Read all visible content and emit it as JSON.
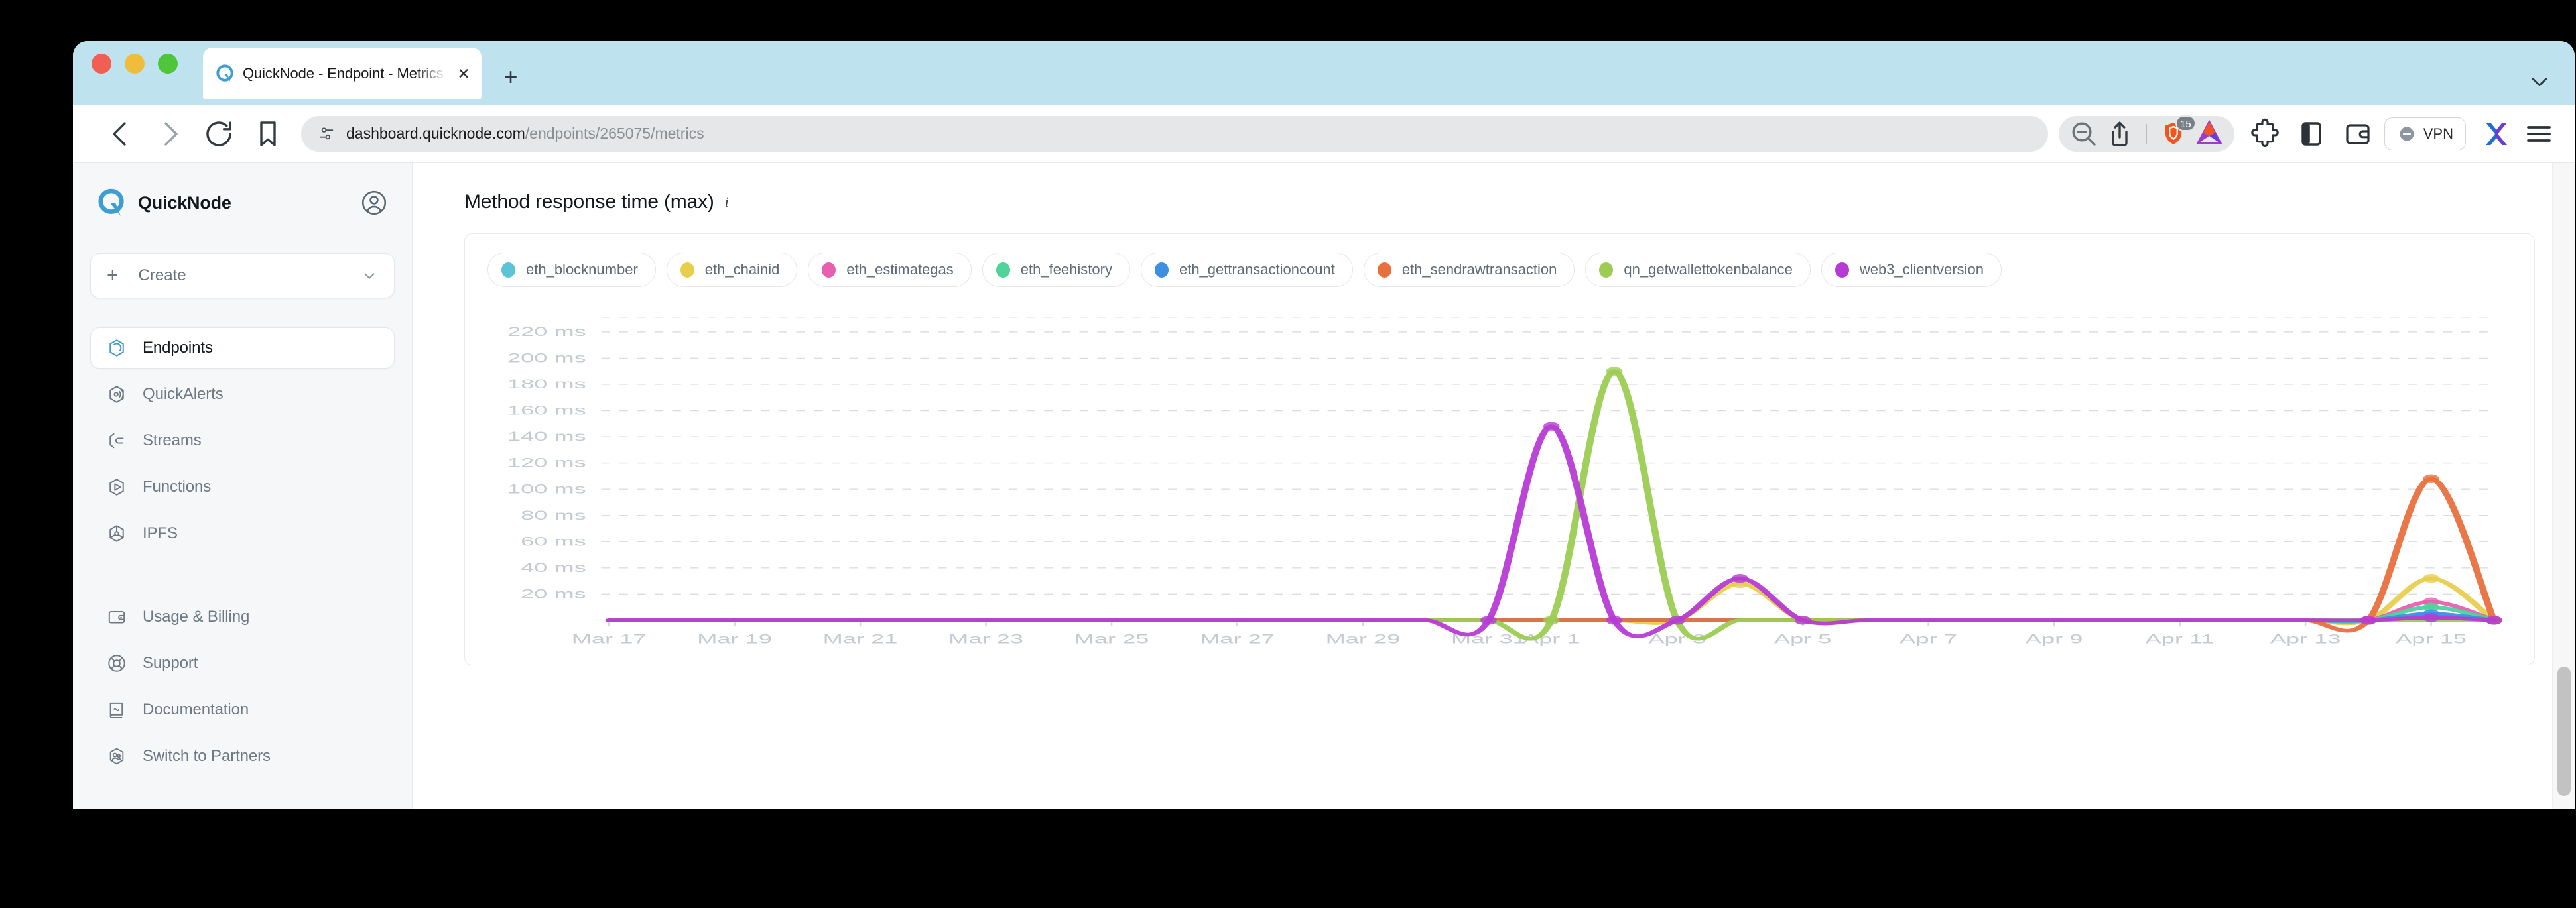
{
  "window": {
    "traffic_lights": [
      "close",
      "minimize",
      "maximize"
    ],
    "tab": {
      "title": "QuickNode - Endpoint - Metrics",
      "favicon": "quicknode-logo-icon",
      "close_icon": "close-icon"
    },
    "new_tab_icon": "plus-icon",
    "tab_list_chevron_icon": "chevron-down-icon"
  },
  "toolbar": {
    "back_icon": "chevron-left-icon",
    "forward_icon": "chevron-right-icon",
    "reload_icon": "reload-icon",
    "bookmark_icon": "bookmark-icon",
    "url": {
      "permission_icon": "site-settings-icon",
      "host": "dashboard.quicknode.com",
      "path": "/endpoints/265075/metrics",
      "full": "dashboard.quicknode.com/endpoints/265075/metrics"
    },
    "zoom_out_icon": "zoom-out-icon",
    "share_icon": "share-icon",
    "shields_icon": "brave-shields-icon",
    "shields_badge": "15",
    "rewards_icon": "brave-rewards-bat-icon",
    "extensions_icon": "extensions-puzzle-icon",
    "sidebar_icon": "sidebar-panel-icon",
    "wallet_icon": "brave-wallet-icon",
    "vpn_label": "VPN",
    "vpn_icon": "vpn-toggle-icon",
    "profile_icon": "profile-x-icon",
    "menu_icon": "hamburger-menu-icon"
  },
  "sidebar": {
    "brand": "QuickNode",
    "brand_logo_icon": "quicknode-logo-icon",
    "account_icon": "account-avatar-icon",
    "create": {
      "label": "Create",
      "plus_icon": "plus-icon",
      "chevron_icon": "chevron-down-icon"
    },
    "primary_items": [
      {
        "label": "Endpoints",
        "icon": "endpoints-icon",
        "active": true
      },
      {
        "label": "QuickAlerts",
        "icon": "quickalerts-icon",
        "active": false
      },
      {
        "label": "Streams",
        "icon": "streams-icon",
        "active": false
      },
      {
        "label": "Functions",
        "icon": "functions-icon",
        "active": false
      },
      {
        "label": "IPFS",
        "icon": "ipfs-icon",
        "active": false
      }
    ],
    "secondary_items": [
      {
        "label": "Usage & Billing",
        "icon": "wallet-icon"
      },
      {
        "label": "Support",
        "icon": "lifebuoy-icon"
      },
      {
        "label": "Documentation",
        "icon": "book-icon"
      },
      {
        "label": "Switch to Partners",
        "icon": "partners-icon"
      }
    ]
  },
  "main": {
    "chart_title": "Method response time (max)",
    "info_icon": "info-icon"
  },
  "chart_data": {
    "type": "line",
    "title": "Method response time (max)",
    "xlabel": "",
    "ylabel": "",
    "ylim": [
      0,
      232
    ],
    "yticks": [
      20,
      40,
      60,
      80,
      100,
      120,
      140,
      160,
      180,
      200,
      220
    ],
    "ytick_labels": [
      "20 ms",
      "40 ms",
      "60 ms",
      "80 ms",
      "100 ms",
      "120 ms",
      "140 ms",
      "160 ms",
      "180 ms",
      "200 ms",
      "220 ms"
    ],
    "grid": true,
    "legend_position": "top-left",
    "x": [
      "Mar 17",
      "Mar 18",
      "Mar 19",
      "Mar 20",
      "Mar 21",
      "Mar 22",
      "Mar 23",
      "Mar 24",
      "Mar 25",
      "Mar 26",
      "Mar 27",
      "Mar 28",
      "Mar 29",
      "Mar 30",
      "Mar 31",
      "Apr 1",
      "Apr 2",
      "Apr 3",
      "Apr 4",
      "Apr 5",
      "Apr 6",
      "Apr 7",
      "Apr 8",
      "Apr 9",
      "Apr 10",
      "Apr 11",
      "Apr 12",
      "Apr 13",
      "Apr 14",
      "Apr 15",
      "Apr 16"
    ],
    "xtick_labels": [
      "Mar 17",
      "Mar 19",
      "Mar 21",
      "Mar 23",
      "Mar 25",
      "Mar 27",
      "Mar 29",
      "Mar 31",
      "Apr 1",
      "Apr 3",
      "Apr 5",
      "Apr 7",
      "Apr 9",
      "Apr 11",
      "Apr 13",
      "Apr 15"
    ],
    "series": [
      {
        "name": "eth_blocknumber",
        "color": "#5bc4d8",
        "values": [
          0,
          0,
          0,
          0,
          0,
          0,
          0,
          0,
          0,
          0,
          0,
          0,
          0,
          0,
          0,
          0,
          0,
          0,
          0,
          0,
          0,
          0,
          0,
          0,
          0,
          0,
          0,
          0,
          0,
          3,
          0
        ]
      },
      {
        "name": "eth_chainid",
        "color": "#e8ce4d",
        "values": [
          0,
          0,
          0,
          0,
          0,
          0,
          0,
          0,
          0,
          0,
          0,
          0,
          0,
          0,
          0,
          0,
          0,
          0,
          28,
          0,
          0,
          0,
          0,
          0,
          0,
          0,
          0,
          0,
          0,
          32,
          0
        ]
      },
      {
        "name": "eth_estimategas",
        "color": "#e85fb0",
        "values": [
          0,
          0,
          0,
          0,
          0,
          0,
          0,
          0,
          0,
          0,
          0,
          0,
          0,
          0,
          0,
          0,
          0,
          0,
          0,
          0,
          0,
          0,
          0,
          0,
          0,
          0,
          0,
          0,
          0,
          14,
          0
        ]
      },
      {
        "name": "eth_feehistory",
        "color": "#4ed39a",
        "values": [
          0,
          0,
          0,
          0,
          0,
          0,
          0,
          0,
          0,
          0,
          0,
          0,
          0,
          0,
          0,
          0,
          0,
          0,
          0,
          0,
          0,
          0,
          0,
          0,
          0,
          0,
          0,
          0,
          0,
          10,
          0
        ]
      },
      {
        "name": "eth_gettransactioncount",
        "color": "#3d8fe0",
        "values": [
          0,
          0,
          0,
          0,
          0,
          0,
          0,
          0,
          0,
          0,
          0,
          0,
          0,
          0,
          0,
          0,
          0,
          0,
          0,
          0,
          0,
          0,
          0,
          0,
          0,
          0,
          0,
          0,
          0,
          5,
          0
        ]
      },
      {
        "name": "eth_sendrawtransaction",
        "color": "#e8703d",
        "values": [
          0,
          0,
          0,
          0,
          0,
          0,
          0,
          0,
          0,
          0,
          0,
          0,
          0,
          0,
          0,
          0,
          0,
          0,
          0,
          0,
          0,
          0,
          0,
          0,
          0,
          0,
          0,
          0,
          0,
          108,
          0
        ]
      },
      {
        "name": "qn_getwallettokenbalance",
        "color": "#9ccc52",
        "values": [
          0,
          0,
          0,
          0,
          0,
          0,
          0,
          0,
          0,
          0,
          0,
          0,
          0,
          0,
          0,
          0,
          190,
          0,
          0,
          0,
          0,
          0,
          0,
          0,
          0,
          0,
          0,
          0,
          0,
          0,
          0
        ]
      },
      {
        "name": "web3_clientversion",
        "color": "#b63bd4",
        "values": [
          0,
          0,
          0,
          0,
          0,
          0,
          0,
          0,
          0,
          0,
          0,
          0,
          0,
          0,
          0,
          148,
          0,
          0,
          32,
          0,
          0,
          0,
          0,
          0,
          0,
          0,
          0,
          0,
          0,
          2,
          0
        ]
      }
    ]
  }
}
